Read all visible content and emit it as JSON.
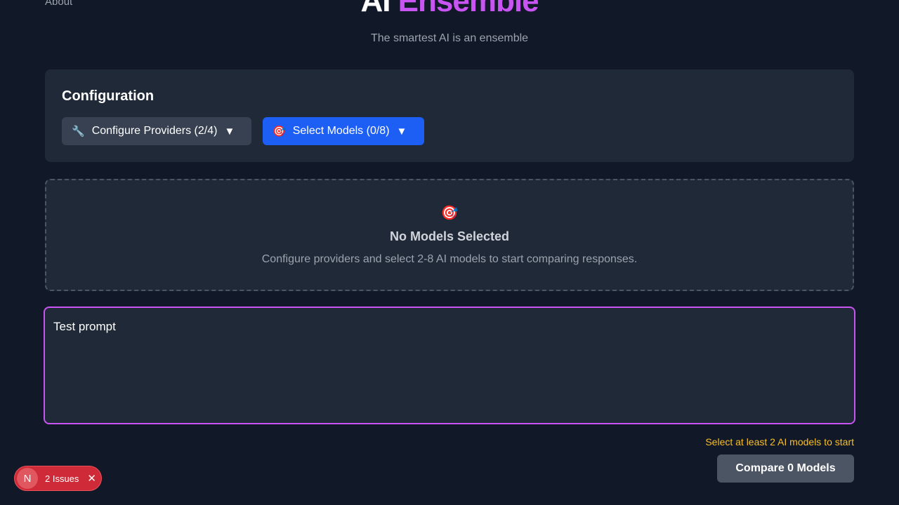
{
  "nav": {
    "about_label": "About"
  },
  "header": {
    "brand_ai": "AI",
    "brand_ensemble": "Ensemble",
    "tagline": "The smartest AI is an ensemble"
  },
  "configuration": {
    "title": "Configuration",
    "providers_icon": "🔧",
    "providers_label": "Configure Providers (2/4)",
    "models_icon": "🎯",
    "models_label": "Select Models (0/8)",
    "caret": "▼"
  },
  "empty_state": {
    "icon": "🎯",
    "title": "No Models Selected",
    "description": "Configure providers and select 2-8 AI models to start comparing responses."
  },
  "prompt": {
    "value": "Test prompt"
  },
  "footer": {
    "warning": "Select at least 2 AI models to start",
    "compare_label": "Compare 0 Models"
  },
  "dev_indicator": {
    "logo": "N",
    "issues_label": "2 Issues",
    "close": "✕"
  },
  "colors": {
    "accent": "#c854f2",
    "primary": "#1d5ff5",
    "warning": "#fbbf24",
    "error": "#cf2a37"
  }
}
